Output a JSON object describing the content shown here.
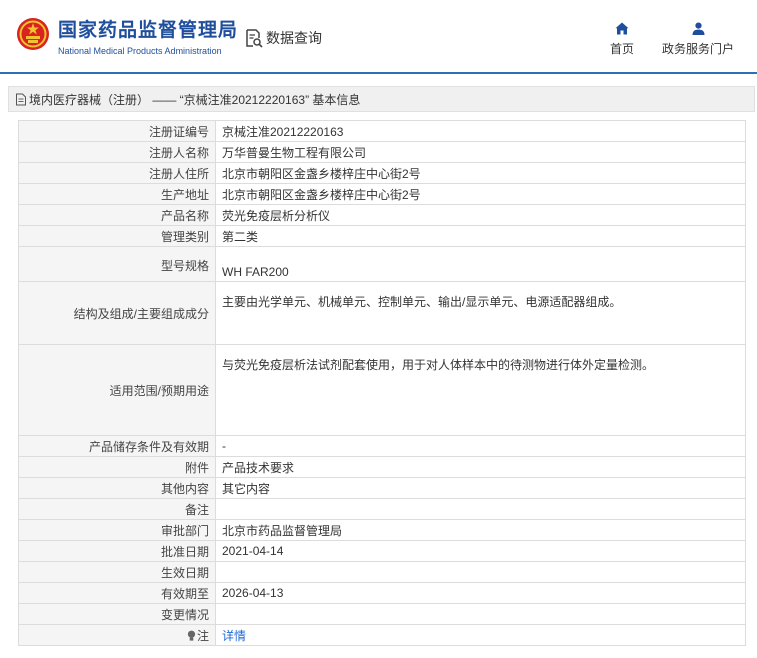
{
  "header": {
    "brand_cn": "国家药品监督管理局",
    "brand_en": "National Medical Products Administration",
    "query_label": "数据查询",
    "nav": {
      "home": "首页",
      "service": "政务服务门户"
    }
  },
  "breadcrumb": {
    "text": "境内医疗器械（注册） —— “京械注准20212220163” 基本信息"
  },
  "rows": [
    {
      "label": "注册证编号",
      "value": "京械注准20212220163"
    },
    {
      "label": "注册人名称",
      "value": "万华普曼生物工程有限公司"
    },
    {
      "label": "注册人住所",
      "value": "北京市朝阳区金盏乡楼梓庄中心街2号"
    },
    {
      "label": "生产地址",
      "value": "北京市朝阳区金盏乡楼梓庄中心街2号"
    },
    {
      "label": "产品名称",
      "value": "荧光免疫层析分析仪"
    },
    {
      "label": "管理类别",
      "value": "第二类"
    },
    {
      "label": "型号规格",
      "value": "WH FAR200"
    },
    {
      "label": "结构及组成/主要组成成分",
      "value": "主要由光学单元、机械单元、控制单元、输出/显示单元、电源适配器组成。"
    },
    {
      "label": "适用范围/预期用途",
      "value": "与荧光免疫层析法试剂配套使用，用于对人体样本中的待测物进行体外定量检测。"
    },
    {
      "label": "产品储存条件及有效期",
      "value": "-"
    },
    {
      "label": "附件",
      "value": "产品技术要求"
    },
    {
      "label": "其他内容",
      "value": "其它内容"
    },
    {
      "label": "备注",
      "value": ""
    },
    {
      "label": "审批部门",
      "value": "北京市药品监督管理局"
    },
    {
      "label": "批准日期",
      "value": "2021-04-14"
    },
    {
      "label": "生效日期",
      "value": ""
    },
    {
      "label": "有效期至",
      "value": "2026-04-13"
    },
    {
      "label": "变更情况",
      "value": ""
    },
    {
      "label": "注",
      "value": "详情"
    }
  ],
  "colors": {
    "brand_blue": "#1f4f9c",
    "header_rule": "#2f6db5",
    "link": "#1e6ad6",
    "logo_red": "#d8231e",
    "logo_gold": "#f2c230"
  },
  "icons": {
    "logo": "national-emblem-icon",
    "query": "search-document-icon",
    "home": "home-icon",
    "service": "user-icon",
    "title": "document-icon",
    "note": "lightbulb-icon"
  }
}
